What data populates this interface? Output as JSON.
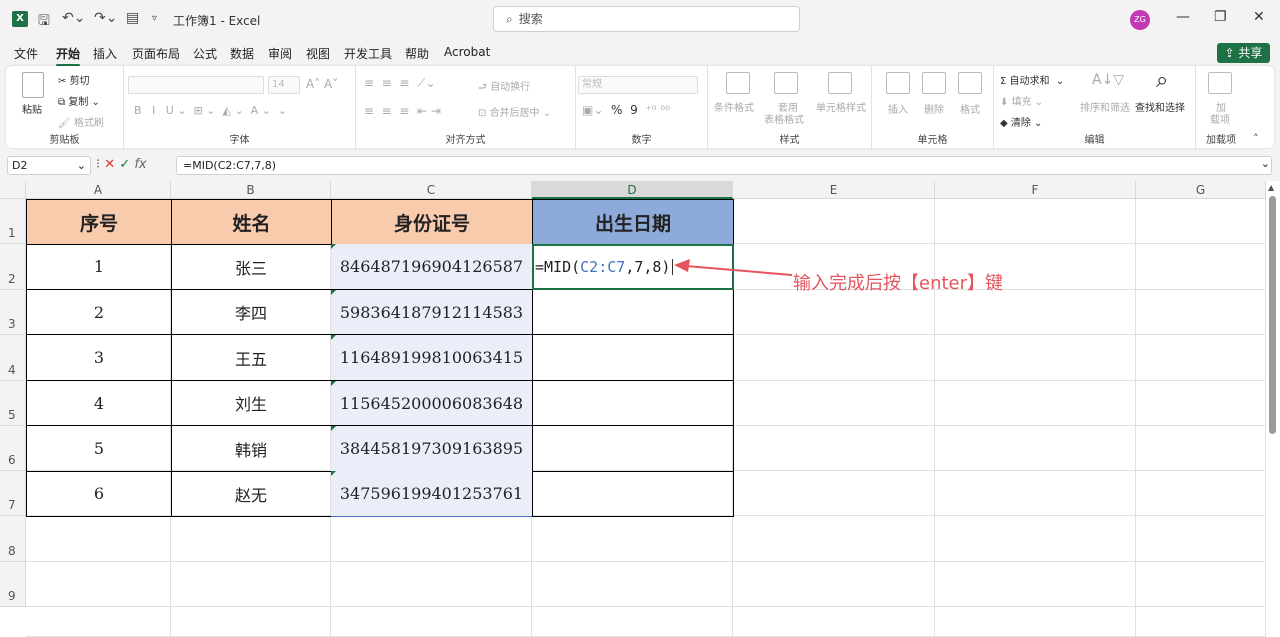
{
  "titlebar": {
    "app_icon": "X",
    "title": "工作簿1 - Excel",
    "search_placeholder": "搜索",
    "avatar": "ZG"
  },
  "menu": [
    "文件",
    "开始",
    "插入",
    "页面布局",
    "公式",
    "数据",
    "审阅",
    "视图",
    "开发工具",
    "帮助",
    "Acrobat"
  ],
  "share_label": "共享",
  "ribbon": {
    "clipboard": {
      "paste": "粘贴",
      "cut": "剪切",
      "copy": "复制",
      "format_painter": "格式刷",
      "label": "剪贴板"
    },
    "font": {
      "font_size": "14",
      "label": "字体"
    },
    "alignment": {
      "wrap": "自动换行",
      "merge": "合并后居中",
      "label": "对齐方式"
    },
    "number": {
      "format": "常规",
      "label": "数字"
    },
    "styles": {
      "cond": "条件格式",
      "table1": "套用",
      "table2": "表格格式",
      "cell": "单元格样式",
      "label": "样式"
    },
    "cells": {
      "insert": "插入",
      "delete": "删除",
      "format": "格式",
      "label": "单元格"
    },
    "editing": {
      "autosum": "自动求和",
      "fill": "填充",
      "clear": "清除",
      "sort": "排序和筛选",
      "find": "查找和选择",
      "label": "编辑"
    },
    "addins": {
      "add1": "加",
      "add2": "载项",
      "label": "加载项"
    }
  },
  "formula_bar": {
    "name_box": "D2",
    "formula": "=MID(C2:C7,7,8)"
  },
  "columns": [
    "A",
    "B",
    "C",
    "D",
    "E",
    "F",
    "G"
  ],
  "rows": [
    "1",
    "2",
    "3",
    "4",
    "5",
    "6",
    "7",
    "8",
    "9"
  ],
  "table": {
    "headers": [
      "序号",
      "姓名",
      "身份证号",
      "出生日期"
    ],
    "rows": [
      {
        "no": "1",
        "name": "张三",
        "id": "846487196904126587"
      },
      {
        "no": "2",
        "name": "李四",
        "id": "598364187912114583"
      },
      {
        "no": "3",
        "name": "王五",
        "id": "116489199810063415"
      },
      {
        "no": "4",
        "name": "刘生",
        "id": "115645200006083648"
      },
      {
        "no": "5",
        "name": "韩销",
        "id": "384458197309163895"
      },
      {
        "no": "6",
        "name": "赵无",
        "id": "347596199401253761"
      }
    ]
  },
  "editing_cell": {
    "prefix": "=MID(",
    "ref": "C2:C7",
    "suffix": ",7,8)"
  },
  "annotation": "输入完成后按【enter】键",
  "colors": {
    "excel_green": "#1e7145",
    "header_orange": "#f8cbad",
    "header_blue": "#8eaadb",
    "annot_red": "#e5555e"
  }
}
